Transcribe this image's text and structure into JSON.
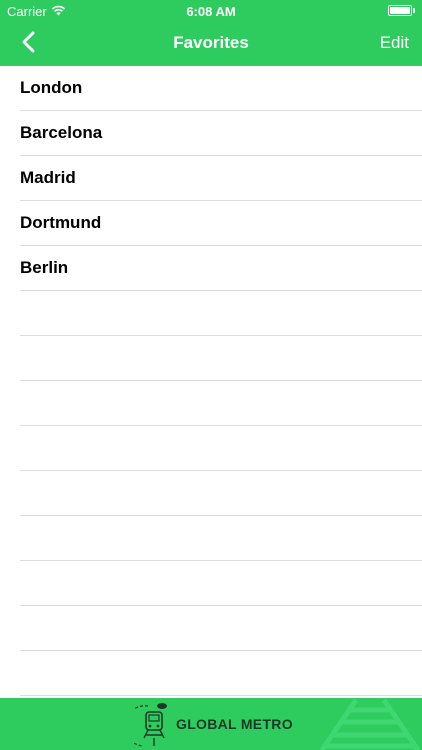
{
  "status": {
    "carrier": "Carrier",
    "time": "6:08 AM"
  },
  "nav": {
    "title": "Favorites",
    "edit_label": "Edit"
  },
  "favorites": [
    "London",
    "Barcelona",
    "Madrid",
    "Dortmund",
    "Berlin"
  ],
  "empty_rows": 9,
  "banner": {
    "text": "GLOBAL METRO"
  },
  "colors": {
    "brand_green": "#2ecc5f",
    "separator": "#dcdcdc"
  },
  "icons": {
    "back": "chevron-left-icon",
    "wifi": "wifi-icon",
    "battery": "battery-icon",
    "logo": "metro-train-icon"
  }
}
